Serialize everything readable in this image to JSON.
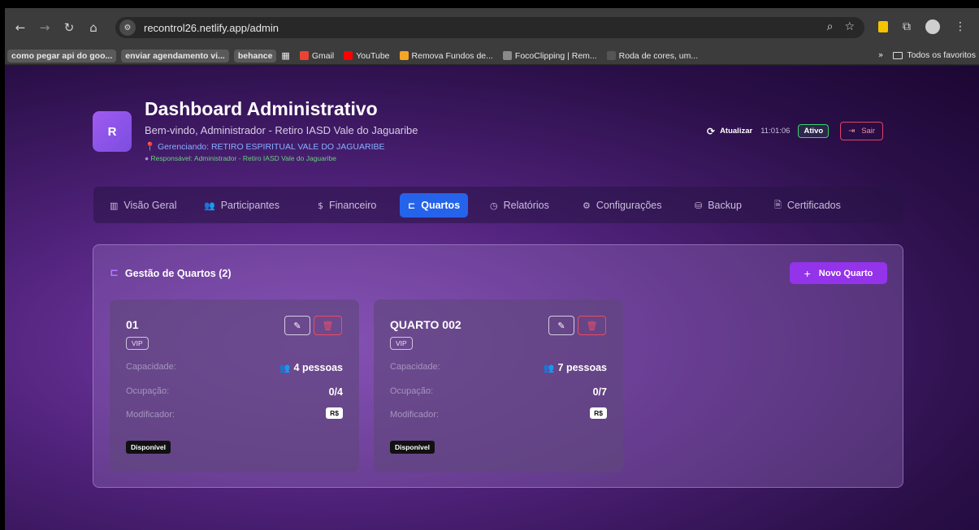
{
  "browser": {
    "url": "recontrol26.netlify.app/admin",
    "bookmarks": [
      {
        "label": "como pegar api do goo...",
        "pill": true,
        "color": ""
      },
      {
        "label": "enviar agendamento vi...",
        "pill": true,
        "color": ""
      },
      {
        "label": "behance",
        "pill": true,
        "color": ""
      },
      {
        "label": "Gmail",
        "pill": false,
        "color": "#ea4335"
      },
      {
        "label": "YouTube",
        "pill": false,
        "color": "#ff0000"
      },
      {
        "label": "Remova Fundos de...",
        "pill": false,
        "color": "#f5a623"
      },
      {
        "label": "FocoClipping | Rem...",
        "pill": false,
        "color": "#8a8a8a"
      },
      {
        "label": "Roda de cores, um...",
        "pill": false,
        "color": "#555555"
      }
    ],
    "all_bookmarks": "Todos os favoritos"
  },
  "header": {
    "logo_letter": "R",
    "title": "Dashboard Administrativo",
    "welcome": "Bem-vindo, Administrador - Retiro IASD Vale do Jaguaribe",
    "managing": "Gerenciando: RETIRO ESPIRITUAL VALE DO JAGUARIBE",
    "responsible": "Responsável: Administrador - Retiro IASD Vale do Jaguaribe",
    "refresh_label": "Atualizar",
    "time": "11:01:06",
    "status": "Ativo",
    "logout_label": "Sair"
  },
  "tabs": [
    {
      "label": "Visão Geral",
      "icon": "bar-chart-icon"
    },
    {
      "label": "Participantes",
      "icon": "users-icon"
    },
    {
      "label": "Financeiro",
      "icon": "dollar-icon"
    },
    {
      "label": "Quartos",
      "icon": "bed-icon",
      "active": true
    },
    {
      "label": "Relatórios",
      "icon": "clock-icon"
    },
    {
      "label": "Configurações",
      "icon": "gear-icon"
    },
    {
      "label": "Backup",
      "icon": "database-icon"
    },
    {
      "label": "Certificados",
      "icon": "document-icon"
    }
  ],
  "rooms_panel": {
    "title": "Gestão de Quartos (2)",
    "new_room_label": "Novo Quarto",
    "rooms": [
      {
        "name": "01",
        "type": "VIP",
        "capacity_label": "Capacidade:",
        "capacity_value": "4 pessoas",
        "occupancy_label": "Ocupação:",
        "occupancy_value": "0/4",
        "modifier_label": "Modificador:",
        "modifier_value": "R$",
        "status": "Disponível"
      },
      {
        "name": "QUARTO 002",
        "type": "VIP",
        "capacity_label": "Capacidade:",
        "capacity_value": "7 pessoas",
        "occupancy_label": "Ocupação:",
        "occupancy_value": "0/7",
        "modifier_label": "Modificador:",
        "modifier_value": "R$",
        "status": "Disponível"
      }
    ]
  },
  "colors": {
    "accent_blue": "#2563eb",
    "accent_purple": "#9333ea",
    "success_green": "#38d46a",
    "danger_red": "#ef4b5c"
  }
}
